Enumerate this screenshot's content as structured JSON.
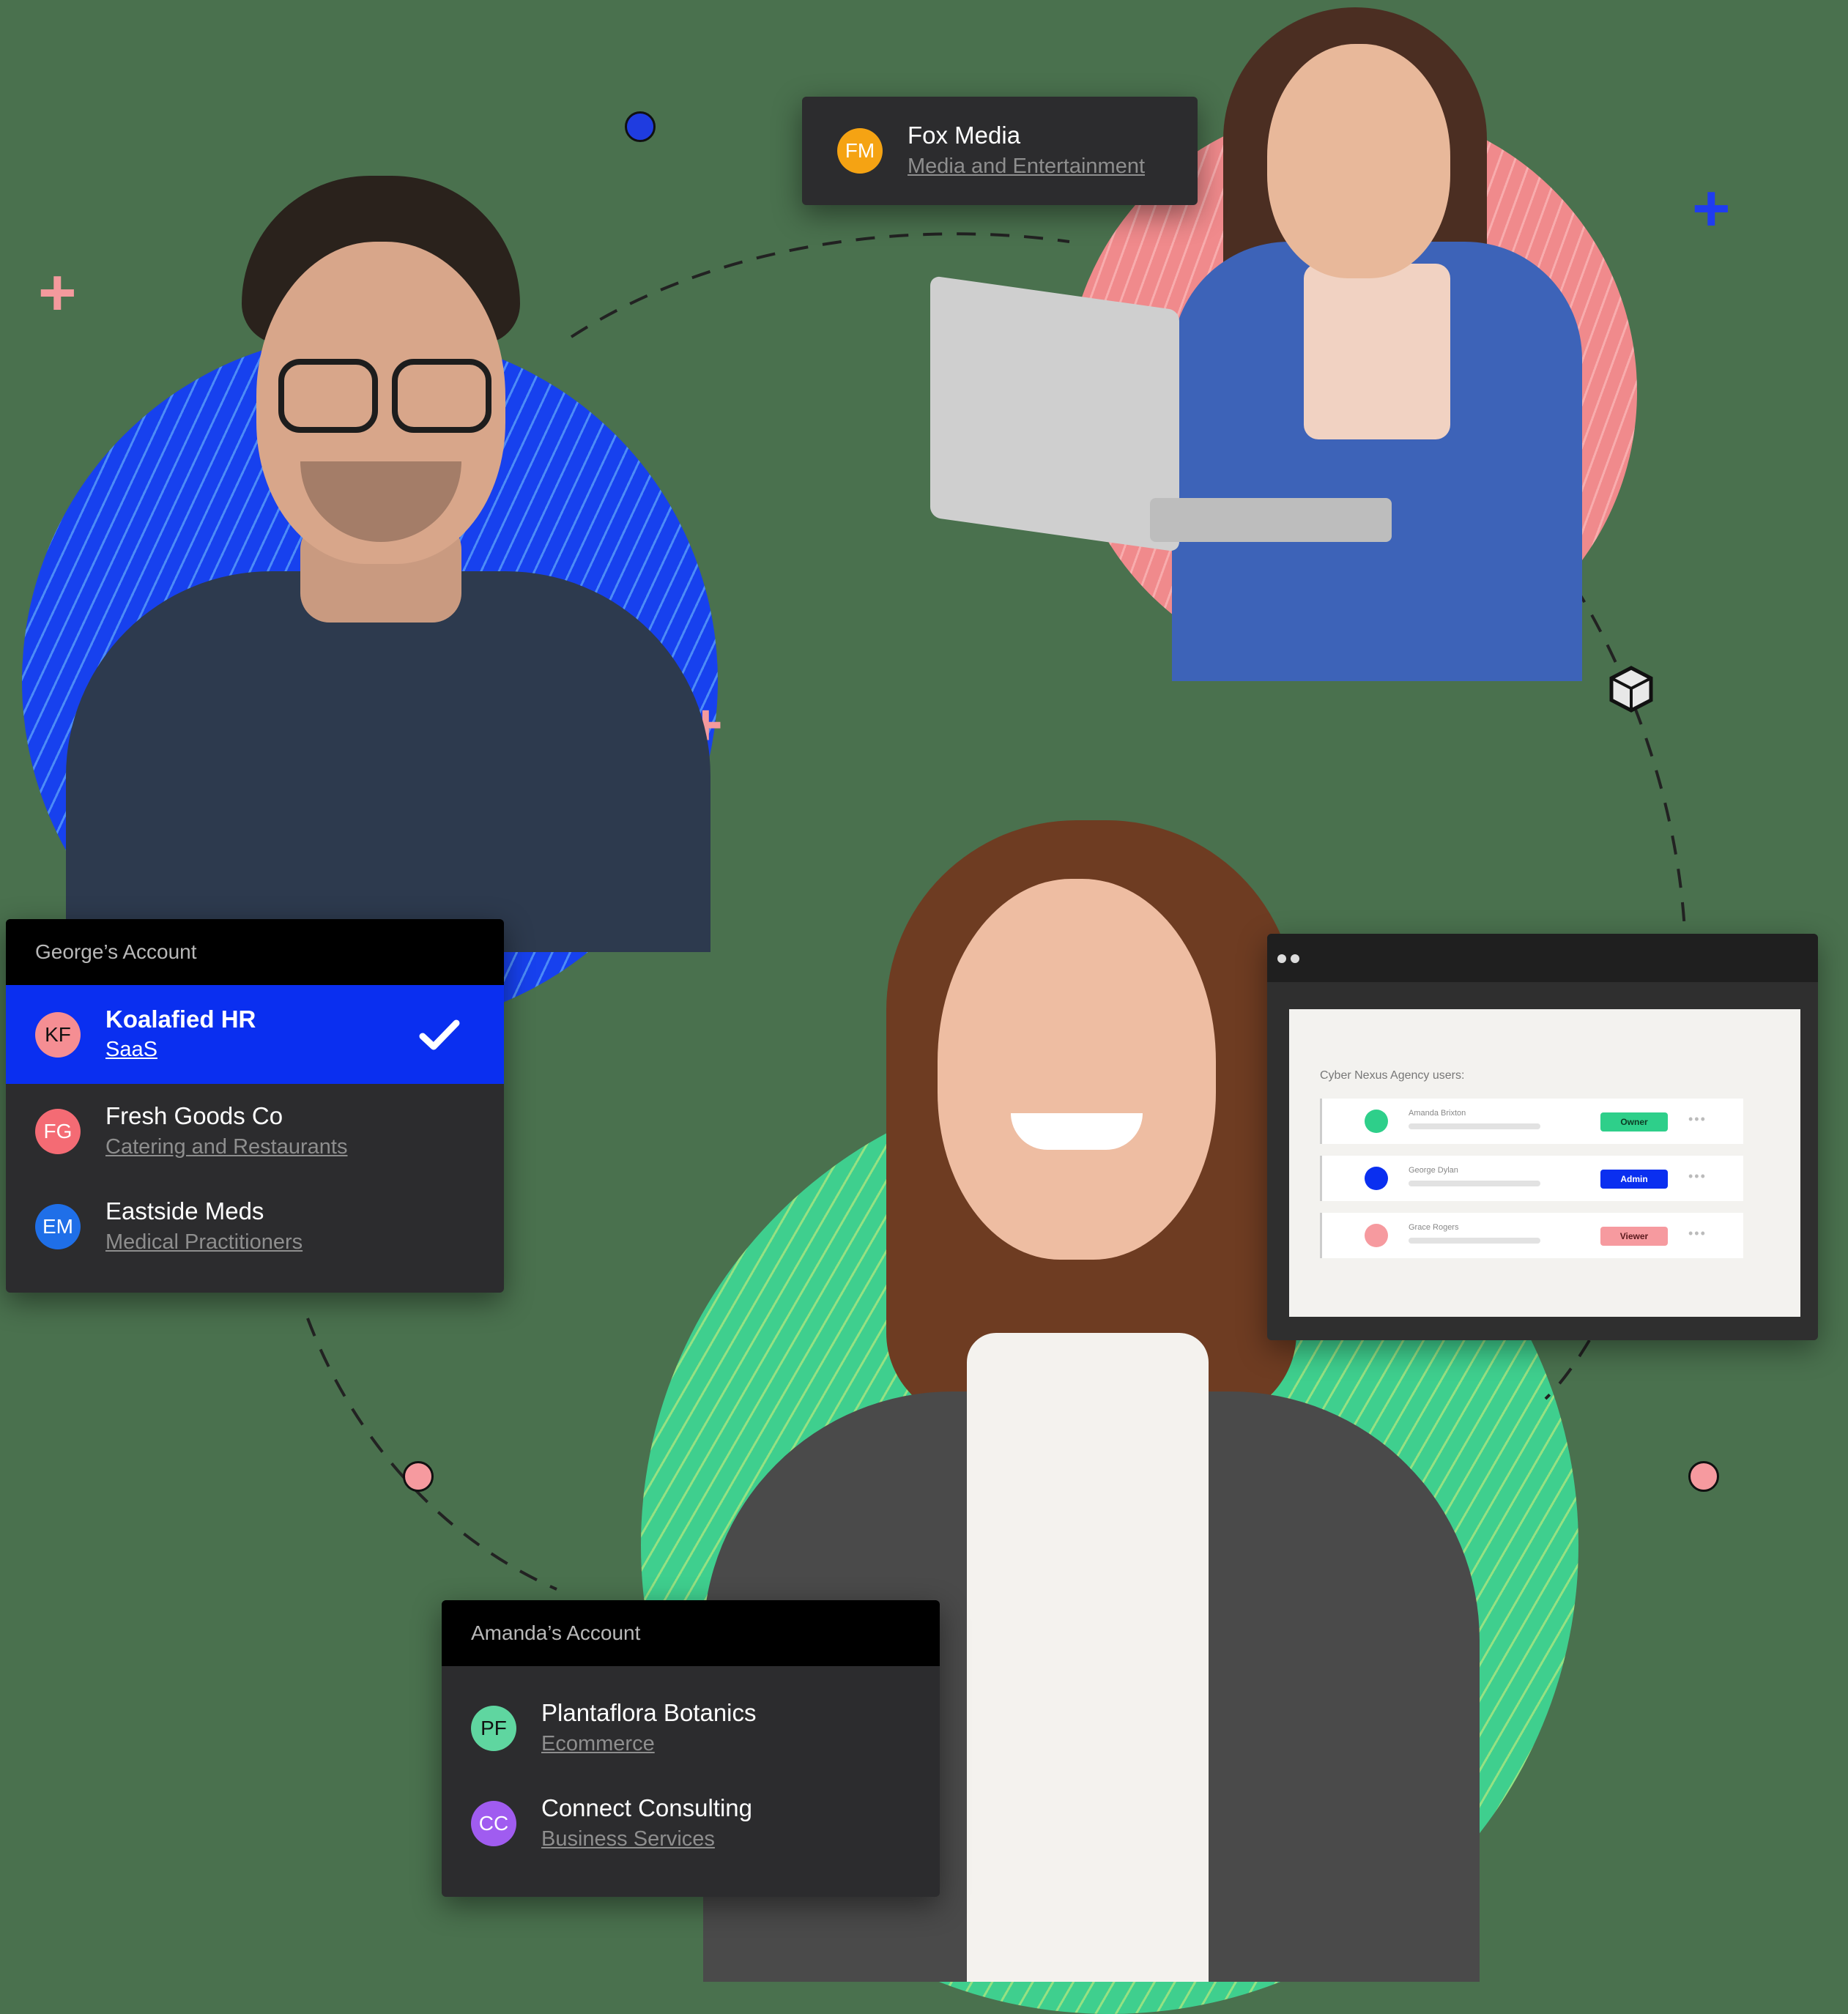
{
  "colors": {
    "background": "#4a714e",
    "card": "#2c2c2e",
    "card_header": "#000000",
    "selected": "#0a2ff0",
    "circle_blue": "#1741ee",
    "circle_pink": "#f08a8c",
    "circle_green": "#3fcf8e"
  },
  "fox_card": {
    "initials": "FM",
    "avatar_color": "#f5a313",
    "name": "Fox Media",
    "category": "Media and Entertainment"
  },
  "georges_account": {
    "title": "George’s Account",
    "items": [
      {
        "initials": "KF",
        "avatar_color": "#f58e93",
        "name": "Koalafied HR",
        "category": "SaaS",
        "selected": true,
        "icon": "checkmark-icon"
      },
      {
        "initials": "FG",
        "avatar_color": "#f46b74",
        "name": "Fresh Goods Co",
        "category": "Catering and Restaurants",
        "selected": false
      },
      {
        "initials": "EM",
        "avatar_color": "#1f6fe8",
        "name": "Eastside Meds",
        "category": "Medical Practitioners",
        "selected": false
      }
    ]
  },
  "amandas_account": {
    "title": "Amanda’s Account",
    "items": [
      {
        "initials": "PF",
        "avatar_color": "#5fd6a0",
        "name": "Plantaflora Botanics",
        "category": "Ecommerce"
      },
      {
        "initials": "CC",
        "avatar_color": "#a05cf0",
        "name": "Connect Consulting",
        "category": "Business Services"
      }
    ]
  },
  "agency_screen": {
    "title": "Cyber Nexus Agency users:",
    "users": [
      {
        "name": "Amanda Brixton",
        "role": "Owner",
        "dot_color": "#2ecf8a",
        "badge_bg": "#2ecf8a",
        "badge_fg": "#0d3b24"
      },
      {
        "name": "George Dylan",
        "role": "Admin",
        "dot_color": "#0a2ff0",
        "badge_bg": "#0a2ff0",
        "badge_fg": "#ffffff"
      },
      {
        "name": "Grace Rogers",
        "role": "Viewer",
        "dot_color": "#f69a9f",
        "badge_bg": "#f69a9f",
        "badge_fg": "#5a1a1e"
      }
    ],
    "more_icon": "more-dots-icon"
  }
}
